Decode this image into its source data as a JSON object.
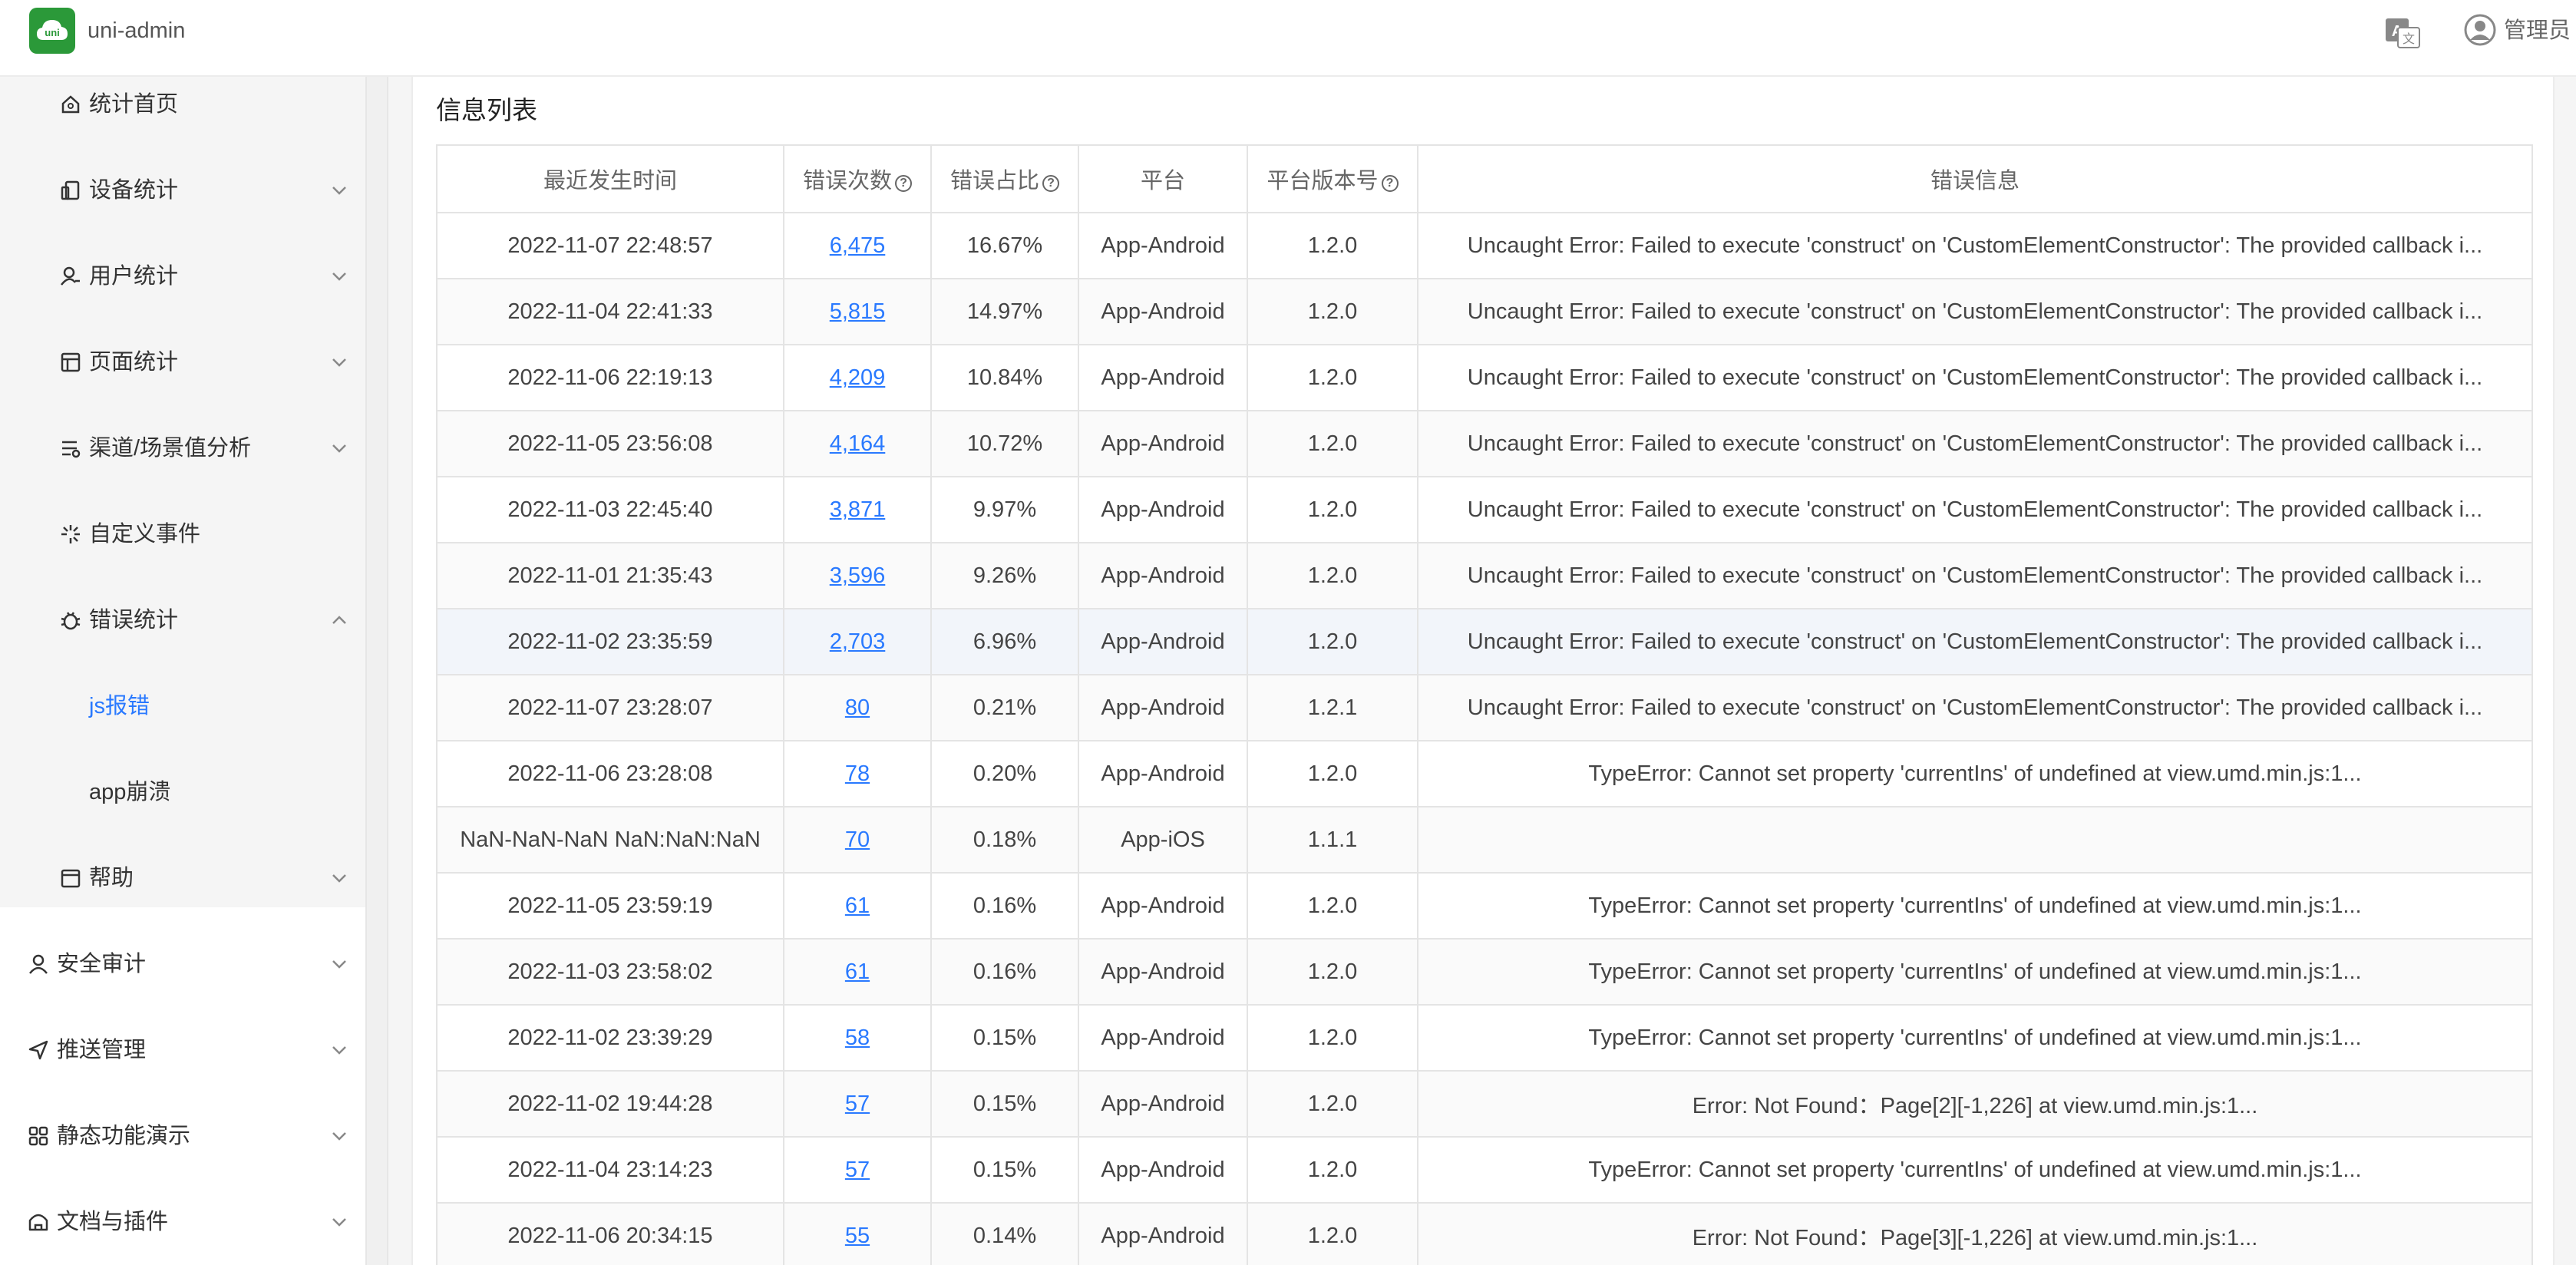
{
  "topbar": {
    "logo_text": "uni",
    "app_name": "uni-admin",
    "user_name": "管理员"
  },
  "sidebar": {
    "items": [
      {
        "label": "统计首页",
        "icon": "home-icon",
        "chevron": false
      },
      {
        "label": "设备统计",
        "icon": "device-icon",
        "chevron": "down"
      },
      {
        "label": "用户统计",
        "icon": "user-stats-icon",
        "chevron": "down"
      },
      {
        "label": "页面统计",
        "icon": "page-stats-icon",
        "chevron": "down"
      },
      {
        "label": "渠道/场景值分析",
        "icon": "channel-icon",
        "chevron": "down"
      },
      {
        "label": "自定义事件",
        "icon": "event-icon",
        "chevron": false
      },
      {
        "label": "错误统计",
        "icon": "error-stats-icon",
        "chevron": "up"
      },
      {
        "label": "js报错",
        "icon": "",
        "chevron": false,
        "active": true
      },
      {
        "label": "app崩溃",
        "icon": "",
        "chevron": false
      },
      {
        "label": "帮助",
        "icon": "help-icon",
        "chevron": "down"
      },
      {
        "label": "安全审计",
        "icon": "security-icon",
        "chevron": "down"
      },
      {
        "label": "推送管理",
        "icon": "push-icon",
        "chevron": "down"
      },
      {
        "label": "静态功能演示",
        "icon": "grid-icon",
        "chevron": "down"
      },
      {
        "label": "文档与插件",
        "icon": "doc-icon",
        "chevron": "down"
      }
    ]
  },
  "main": {
    "section_title": "信息列表",
    "table": {
      "headers": [
        "最近发生时间",
        "错误次数",
        "错误占比",
        "平台",
        "平台版本号",
        "错误信息"
      ],
      "header_help": [
        false,
        true,
        true,
        false,
        true,
        false
      ],
      "rows": [
        [
          "2022-11-07 22:48:57",
          "6,475",
          "16.67%",
          "App-Android",
          "1.2.0",
          "Uncaught Error: Failed to execute 'construct' on 'CustomElementConstructor': The provided callback i..."
        ],
        [
          "2022-11-04 22:41:33",
          "5,815",
          "14.97%",
          "App-Android",
          "1.2.0",
          "Uncaught Error: Failed to execute 'construct' on 'CustomElementConstructor': The provided callback i..."
        ],
        [
          "2022-11-06 22:19:13",
          "4,209",
          "10.84%",
          "App-Android",
          "1.2.0",
          "Uncaught Error: Failed to execute 'construct' on 'CustomElementConstructor': The provided callback i..."
        ],
        [
          "2022-11-05 23:56:08",
          "4,164",
          "10.72%",
          "App-Android",
          "1.2.0",
          "Uncaught Error: Failed to execute 'construct' on 'CustomElementConstructor': The provided callback i..."
        ],
        [
          "2022-11-03 22:45:40",
          "3,871",
          "9.97%",
          "App-Android",
          "1.2.0",
          "Uncaught Error: Failed to execute 'construct' on 'CustomElementConstructor': The provided callback i..."
        ],
        [
          "2022-11-01 21:35:43",
          "3,596",
          "9.26%",
          "App-Android",
          "1.2.0",
          "Uncaught Error: Failed to execute 'construct' on 'CustomElementConstructor': The provided callback i..."
        ],
        [
          "2022-11-02 23:35:59",
          "2,703",
          "6.96%",
          "App-Android",
          "1.2.0",
          "Uncaught Error: Failed to execute 'construct' on 'CustomElementConstructor': The provided callback i..."
        ],
        [
          "2022-11-07 23:28:07",
          "80",
          "0.21%",
          "App-Android",
          "1.2.1",
          "Uncaught Error: Failed to execute 'construct' on 'CustomElementConstructor': The provided callback i..."
        ],
        [
          "2022-11-06 23:28:08",
          "78",
          "0.20%",
          "App-Android",
          "1.2.0",
          "TypeError: Cannot set property 'currentIns' of undefined at view.umd.min.js:1..."
        ],
        [
          "NaN-NaN-NaN NaN:NaN:NaN",
          "70",
          "0.18%",
          "App-iOS",
          "1.1.1",
          ""
        ],
        [
          "2022-11-05 23:59:19",
          "61",
          "0.16%",
          "App-Android",
          "1.2.0",
          "TypeError: Cannot set property 'currentIns' of undefined at view.umd.min.js:1..."
        ],
        [
          "2022-11-03 23:58:02",
          "61",
          "0.16%",
          "App-Android",
          "1.2.0",
          "TypeError: Cannot set property 'currentIns' of undefined at view.umd.min.js:1..."
        ],
        [
          "2022-11-02 23:39:29",
          "58",
          "0.15%",
          "App-Android",
          "1.2.0",
          "TypeError: Cannot set property 'currentIns' of undefined at view.umd.min.js:1..."
        ],
        [
          "2022-11-02 19:44:28",
          "57",
          "0.15%",
          "App-Android",
          "1.2.0",
          "Error: Not Found：Page[2][-1,226] at view.umd.min.js:1..."
        ],
        [
          "2022-11-04 23:14:23",
          "57",
          "0.15%",
          "App-Android",
          "1.2.0",
          "TypeError: Cannot set property 'currentIns' of undefined at view.umd.min.js:1..."
        ],
        [
          "2022-11-06 20:34:15",
          "55",
          "0.14%",
          "App-Android",
          "1.2.0",
          "Error: Not Found：Page[3][-1,226] at view.umd.min.js:1..."
        ]
      ]
    }
  },
  "colors": {
    "brand_green": "#2b9939",
    "link_blue": "#2979ff",
    "sidebar_bg": "#f5f5f5"
  }
}
